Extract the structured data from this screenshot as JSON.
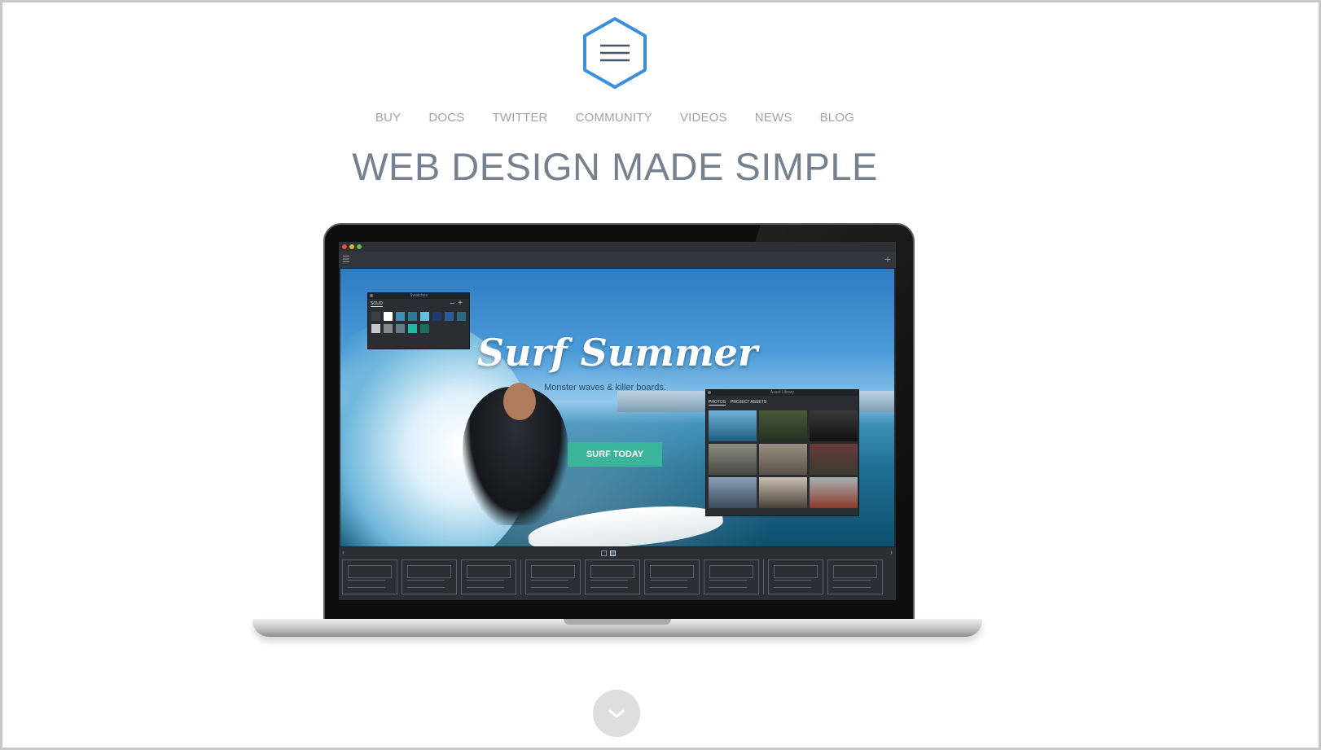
{
  "nav": {
    "items": [
      "BUY",
      "DOCS",
      "TWITTER",
      "COMMUNITY",
      "VIDEOS",
      "NEWS",
      "BLOG"
    ]
  },
  "headline": "WEB DESIGN MADE SIMPLE",
  "app": {
    "hero": {
      "title": "Surf Summer",
      "subtitle": "Monster waves & killer boards.",
      "button": "SURF TODAY"
    },
    "swatches_panel": {
      "title": "Swatches",
      "tab": "SOLID",
      "colors": [
        "#3b3f46",
        "#ffffff",
        "#3e8fb6",
        "#2a7a9b",
        "#5fc2dc",
        "#1f3b6b",
        "#2d5a9a",
        "#2b6a7a",
        "#c7c7c7",
        "#8a8a8a",
        "#667c8c",
        "#20b8a4",
        "#1d6d5e"
      ]
    },
    "assets_panel": {
      "title": "Asset Library",
      "tabs": [
        "PHOTOS",
        "PROJECT ASSETS"
      ],
      "active_tab": "PHOTOS"
    }
  },
  "colors": {
    "accent_blue": "#3a8fde",
    "nav_text": "#9aa4b0",
    "headline_text": "#75818f",
    "hero_button": "#3ab59a"
  },
  "icons": {
    "logo": "hexagon-menu-icon",
    "scroll": "chevron-down-icon"
  }
}
